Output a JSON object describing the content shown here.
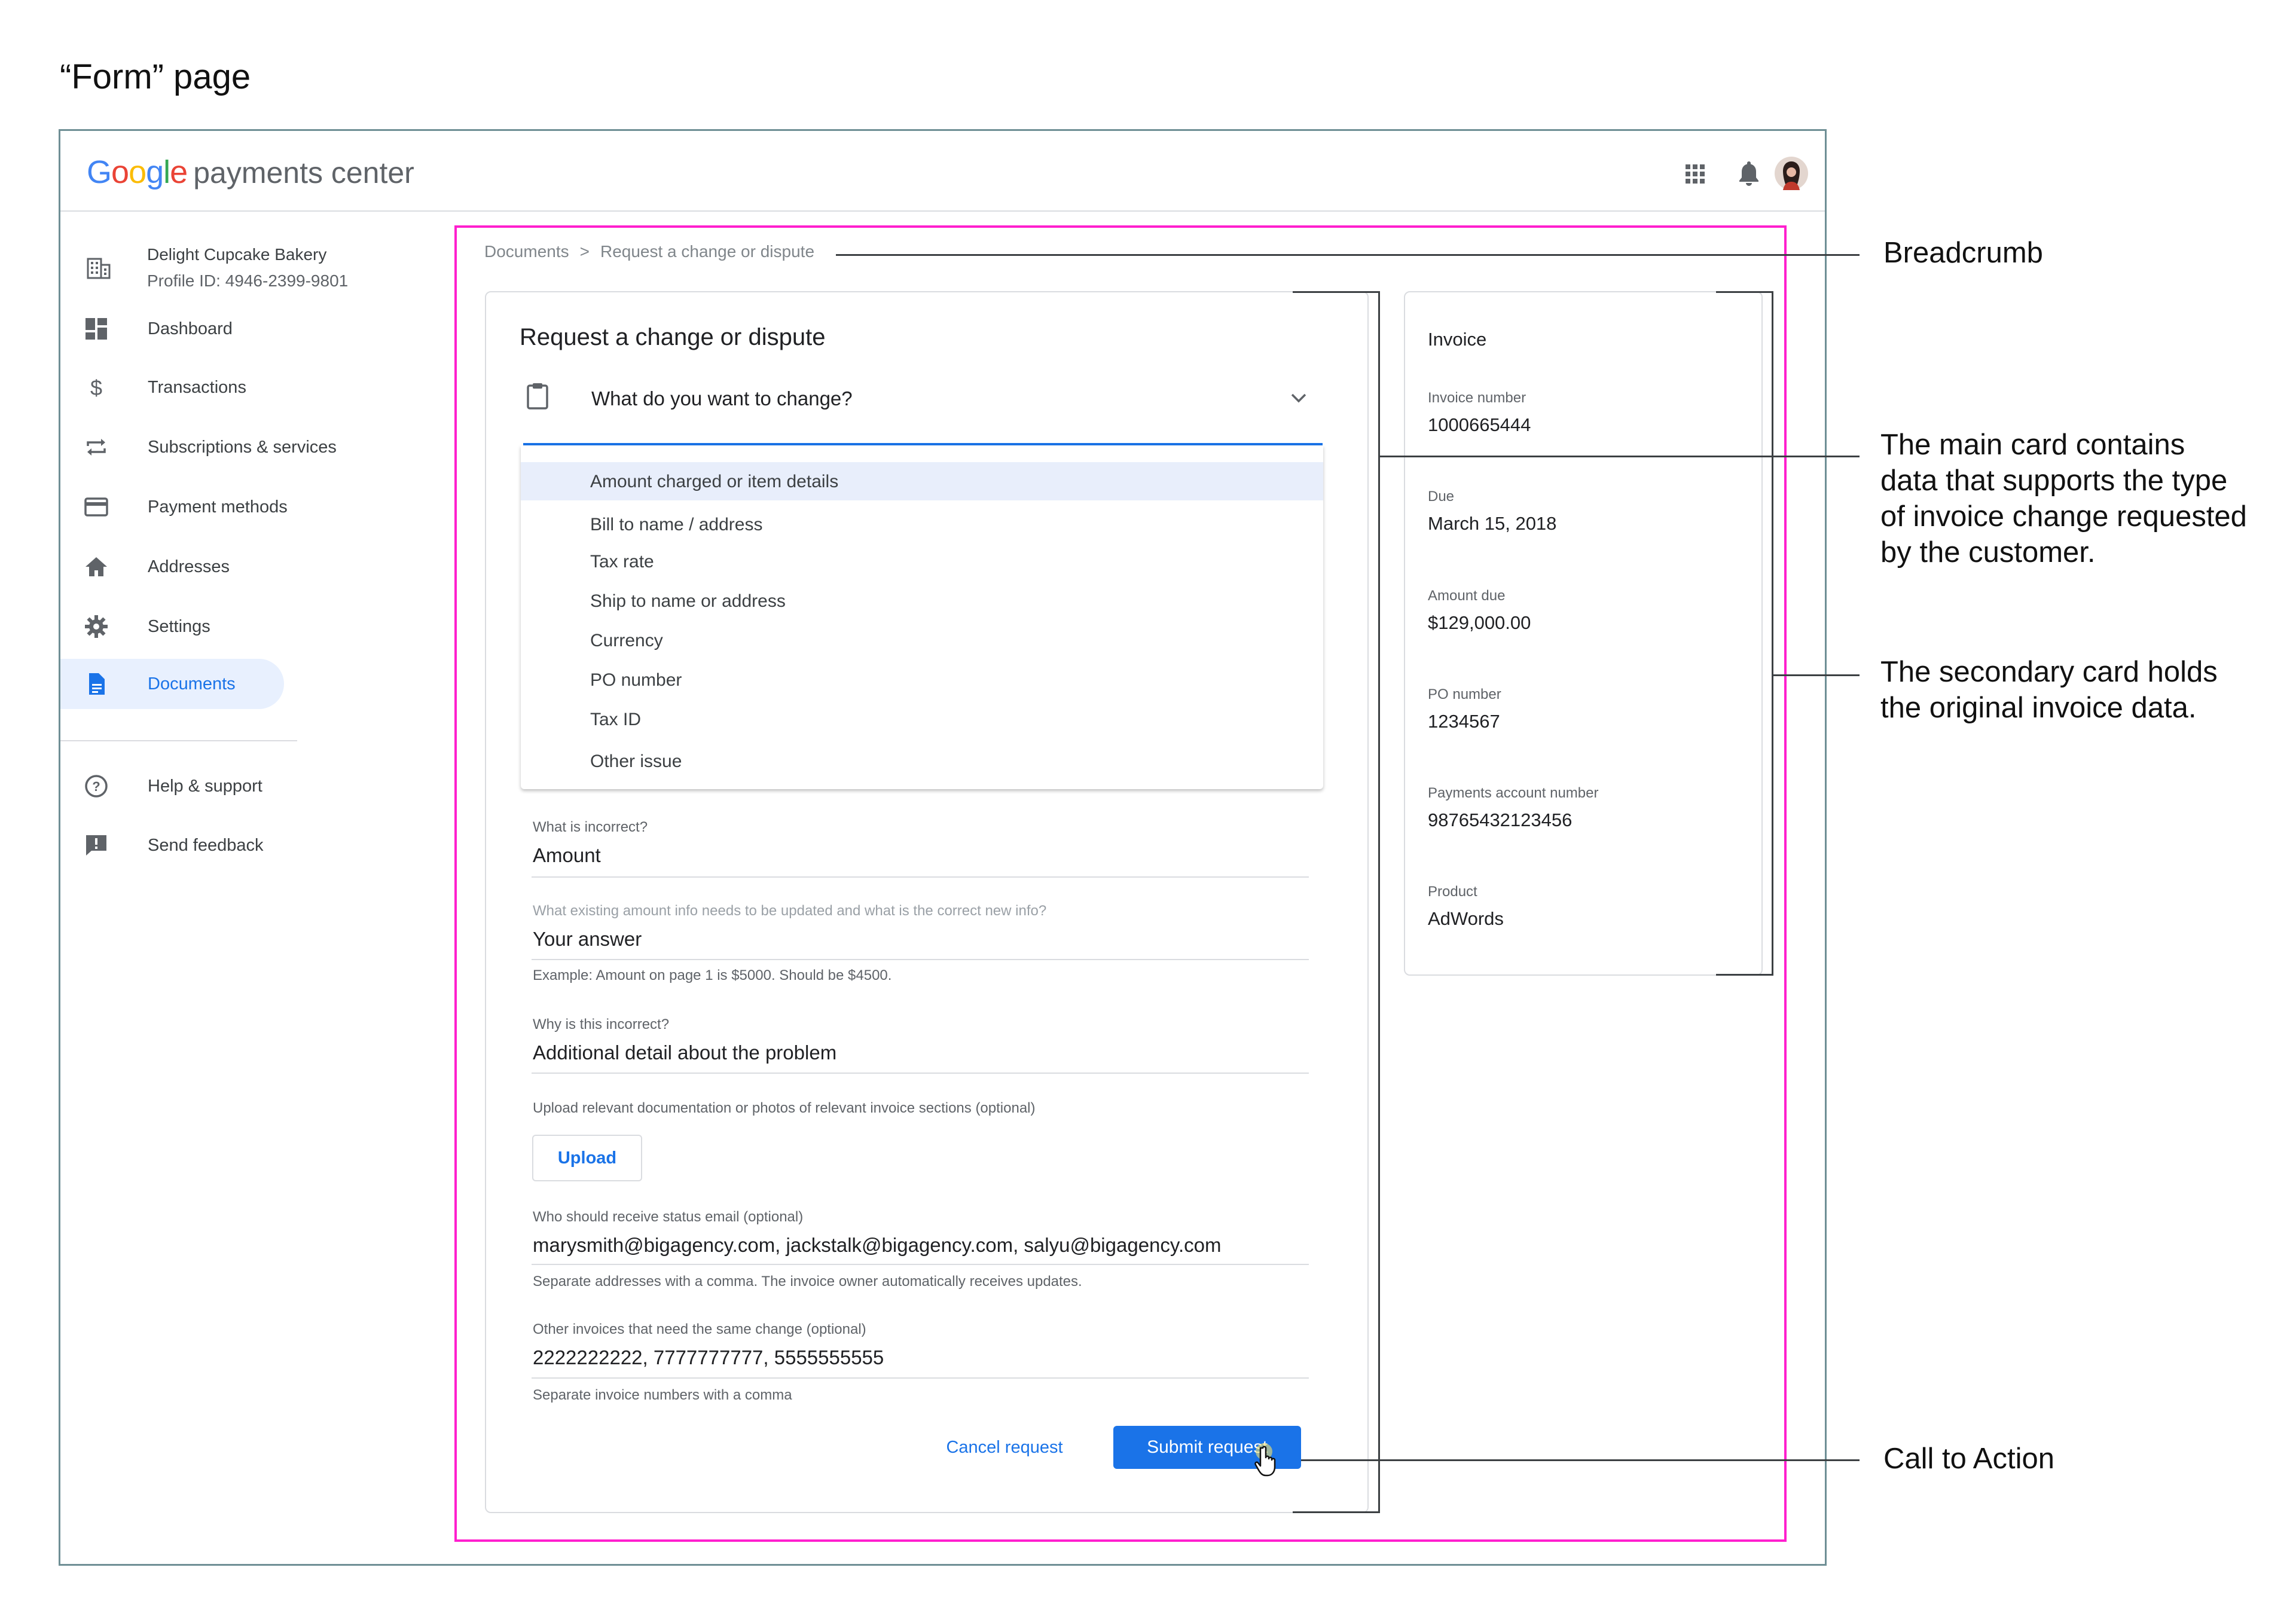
{
  "page_heading": "“Form” page",
  "header": {
    "logo_word": "Google",
    "logo_suffix": "payments center",
    "icons": [
      "apps-grid-icon",
      "bell-icon",
      "avatar"
    ]
  },
  "sidebar": {
    "account_name": "Delight Cupcake Bakery",
    "profile_id": "Profile ID: 4946-2399-9801",
    "items": [
      {
        "label": "Dashboard",
        "icon": "dashboard-icon"
      },
      {
        "label": "Transactions",
        "icon": "dollar-icon"
      },
      {
        "label": "Subscriptions & services",
        "icon": "repeat-icon"
      },
      {
        "label": "Payment methods",
        "icon": "credit-card-icon"
      },
      {
        "label": "Addresses",
        "icon": "home-icon"
      },
      {
        "label": "Settings",
        "icon": "gear-icon"
      },
      {
        "label": "Documents",
        "icon": "document-icon",
        "active": true
      }
    ],
    "footer_items": [
      {
        "label": "Help & support",
        "icon": "help-icon"
      },
      {
        "label": "Send feedback",
        "icon": "feedback-icon"
      }
    ]
  },
  "breadcrumb": {
    "root": "Documents",
    "separator": ">",
    "current": "Request a change or dispute"
  },
  "main_card": {
    "title": "Request a change or dispute",
    "select_label": "What do you want to change?",
    "options": [
      "Amount charged or item details",
      "Bill to name / address",
      "Tax rate",
      "Ship to name or address",
      "Currency",
      "PO number",
      "Tax ID",
      "Other issue"
    ],
    "selected_option_index": 0,
    "fields": {
      "incorrect": {
        "label": "What is incorrect?",
        "value": "Amount"
      },
      "amount_info": {
        "label": "What existing amount info needs to be updated and what is the correct new info?",
        "value": "Your answer",
        "help": "Example: Amount on page 1 is $5000. Should be $4500."
      },
      "why": {
        "label": "Why is this incorrect?",
        "value": "Additional detail about the problem"
      },
      "upload": {
        "label": "Upload relevant documentation or photos of relevant invoice sections (optional)",
        "button": "Upload"
      },
      "emails": {
        "label": "Who should receive status email (optional)",
        "value": "marysmith@bigagency.com, jackstalk@bigagency.com, salyu@bigagency.com",
        "help": "Separate addresses with a comma. The invoice owner automatically receives updates."
      },
      "other_invoices": {
        "label": "Other invoices that need the same change (optional)",
        "value": "2222222222, 7777777777, 5555555555",
        "help": "Separate invoice numbers with a comma"
      }
    },
    "cancel_label": "Cancel request",
    "submit_label": "Submit request"
  },
  "invoice_card": {
    "title": "Invoice",
    "rows": [
      {
        "label": "Invoice number",
        "value": "1000665444"
      },
      {
        "label": "Due",
        "value": "March 15, 2018"
      },
      {
        "label": "Amount due",
        "value": "$129,000.00"
      },
      {
        "label": "PO number",
        "value": "1234567"
      },
      {
        "label": "Payments account number",
        "value": "98765432123456"
      },
      {
        "label": "Product",
        "value": "AdWords"
      }
    ]
  },
  "annotations": {
    "breadcrumb": "Breadcrumb",
    "main_card_line1": "The main card contains",
    "main_card_line2": "data that supports the type",
    "main_card_line3": "of invoice change requested",
    "main_card_line4": "by the customer.",
    "secondary_line1": "The secondary card holds",
    "secondary_line2": "the original invoice data.",
    "cta": "Call to Action"
  },
  "colors": {
    "accent": "#1a73e8",
    "highlight_frame": "#ff1fce",
    "frame": "#6f8f95"
  }
}
